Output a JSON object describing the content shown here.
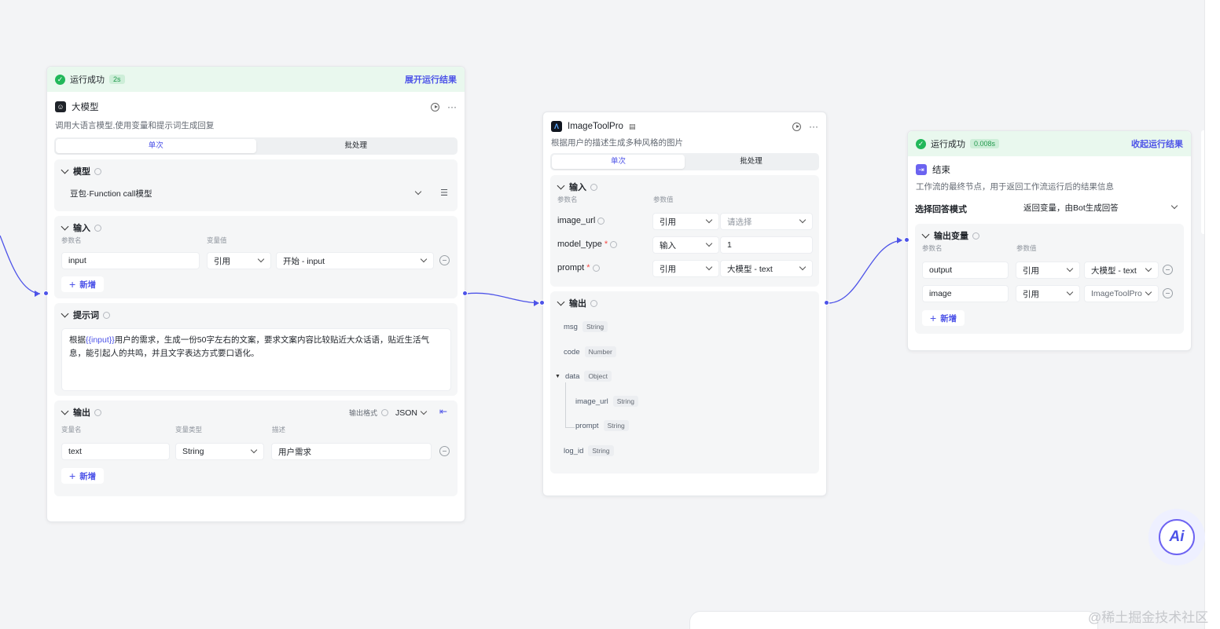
{
  "llm_node": {
    "run_status": "运行成功",
    "run_time": "2s",
    "run_link": "展开运行结果",
    "title": "大模型",
    "description": "调用大语言模型,使用变量和提示词生成回复",
    "tabs": [
      "单次",
      "批处理"
    ],
    "model_section": {
      "title": "模型",
      "value": "豆包·Function call模型"
    },
    "input_section": {
      "title": "输入",
      "col_name": "参数名",
      "col_value": "变量值",
      "rows": [
        {
          "name": "input",
          "mode": "引用",
          "value": "开始 - input"
        }
      ],
      "add_label": "新增"
    },
    "prompt_section": {
      "title": "提示词",
      "text_before": "根据",
      "variable": "{{input}}",
      "text_after": "用户的需求，生成一份50字左右的文案，要求文案内容比较贴近大众话语，贴近生活气息，能引起人的共鸣，并且文字表达方式要口语化。"
    },
    "output_section": {
      "title": "输出",
      "format_label": "输出格式",
      "format_value": "JSON",
      "col_name": "变量名",
      "col_type": "变量类型",
      "col_desc": "描述",
      "rows": [
        {
          "name": "text",
          "type": "String",
          "desc": "用户需求"
        }
      ],
      "add_label": "新增"
    }
  },
  "tool_node": {
    "title": "ImageToolPro",
    "description": "根据用户的描述生成多种风格的图片",
    "tabs": [
      "单次",
      "批处理"
    ],
    "input_section": {
      "title": "输入",
      "col_name": "参数名",
      "col_value": "参数值",
      "rows": [
        {
          "name": "image_url",
          "required": false,
          "mode": "引用",
          "value": "请选择",
          "placeholder": true
        },
        {
          "name": "model_type",
          "required": true,
          "mode": "输入",
          "value": "1",
          "placeholder": false
        },
        {
          "name": "prompt",
          "required": true,
          "mode": "引用",
          "value": "大模型 - text",
          "placeholder": false
        }
      ]
    },
    "output_section": {
      "title": "输出",
      "items": [
        {
          "name": "msg",
          "type": "String"
        },
        {
          "name": "code",
          "type": "Number"
        },
        {
          "name": "data",
          "type": "Object"
        },
        {
          "name": "image_url",
          "type": "String"
        },
        {
          "name": "prompt",
          "type": "String"
        },
        {
          "name": "log_id",
          "type": "String"
        }
      ]
    }
  },
  "end_node": {
    "run_status": "运行成功",
    "run_time": "0.008s",
    "run_link": "收起运行结果",
    "title": "结束",
    "description": "工作流的最终节点，用于返回工作流运行后的结果信息",
    "answer_mode_label": "选择回答模式",
    "answer_mode_value": "返回变量，由Bot生成回答",
    "output_section": {
      "title": "输出变量",
      "col_name": "参数名",
      "col_value": "参数值",
      "rows": [
        {
          "name": "output",
          "mode": "引用",
          "value": "大模型 - text"
        },
        {
          "name": "image",
          "mode": "引用",
          "value": "ImageToolPro"
        }
      ],
      "add_label": "新增"
    }
  },
  "ai_button": {
    "label": "Ai"
  },
  "watermark": "@稀土掘金技术社区",
  "colors": {
    "accent": "#4d53e8",
    "success": "#22b85a",
    "success_bg": "#e9f8ee"
  }
}
